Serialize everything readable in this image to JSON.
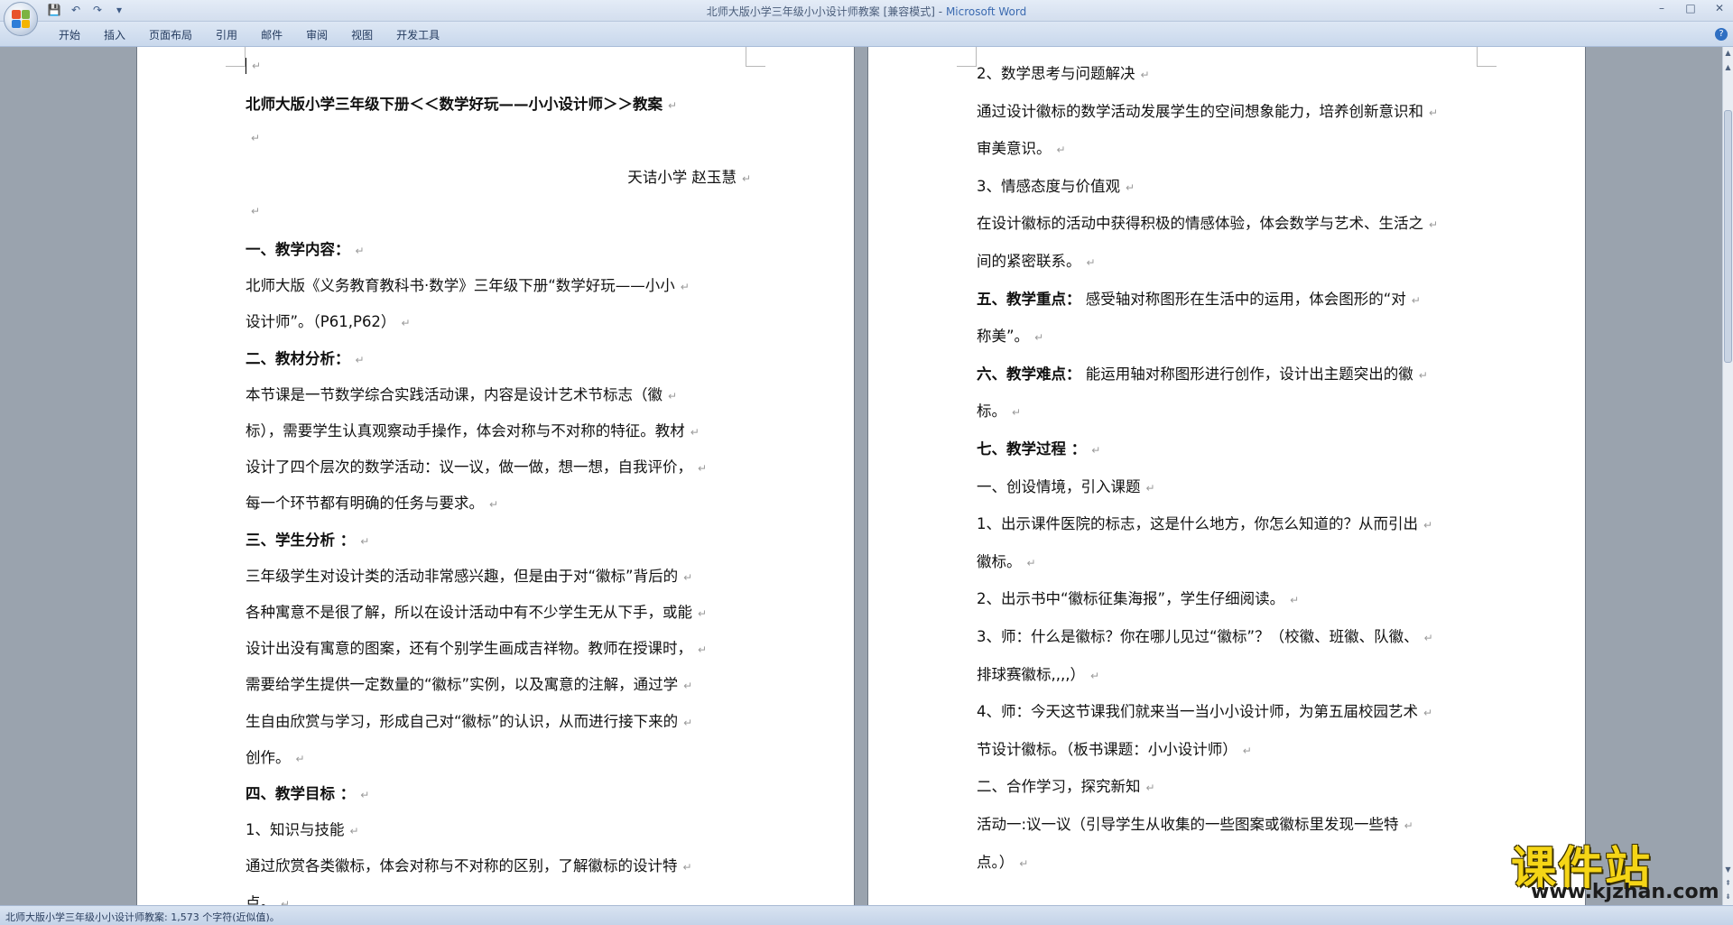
{
  "window": {
    "title_doc": "北师大版小学三年级小小设计师教案 [兼容模式]",
    "title_sep": " - ",
    "title_app": "Microsoft Word",
    "minimize": "–",
    "maximize": "□",
    "close": "✕"
  },
  "qat": {
    "save": "💾",
    "undo": "↶",
    "redo": "↷",
    "more": "▾"
  },
  "ribbon": {
    "tabs": [
      "开始",
      "插入",
      "页面布局",
      "引用",
      "邮件",
      "审阅",
      "视图",
      "开发工具"
    ],
    "help": "?"
  },
  "page1": {
    "lines": [
      {
        "text": "",
        "bold": false
      },
      {
        "text": "北师大版小学三年级下册＜＜数学好玩——小小设计师＞＞教案",
        "bold": true
      },
      {
        "text": "",
        "bold": false
      },
      {
        "text": "天诘小学    赵玉慧",
        "bold": false,
        "align": "right"
      },
      {
        "text": "",
        "bold": false
      },
      {
        "text": "一、教学内容：",
        "bold": true
      },
      {
        "text": "北师大版《义务教育教科书·数学》三年级下册“数学好玩——小小",
        "bold": false
      },
      {
        "text": "设计师”。（P61,P62）",
        "bold": false
      },
      {
        "text": "二、教材分析：",
        "bold": true
      },
      {
        "text": "  本节课是一节数学综合实践活动课，内容是设计艺术节标志（徽",
        "bold": false
      },
      {
        "text": "标），需要学生认真观察动手操作，体会对称与不对称的特征。教材",
        "bold": false
      },
      {
        "text": "设计了四个层次的数学活动：议一议，做一做，想一想，自我评价，",
        "bold": false
      },
      {
        "text": "每一个环节都有明确的任务与要求。",
        "bold": false
      },
      {
        "text": "三、学生分析  ：",
        "bold": true
      },
      {
        "text": "三年级学生对设计类的活动非常感兴趣，但是由于对“徽标”背后的",
        "bold": false
      },
      {
        "text": "各种寓意不是很了解，所以在设计活动中有不少学生无从下手，或能",
        "bold": false
      },
      {
        "text": "设计出没有寓意的图案，还有个别学生画成吉祥物。教师在授课时，",
        "bold": false
      },
      {
        "text": "需要给学生提供一定数量的“徽标”实例，以及寓意的注解，通过学",
        "bold": false
      },
      {
        "text": "生自由欣赏与学习，形成自己对“徽标”的认识，从而进行接下来的",
        "bold": false
      },
      {
        "text": "创作。",
        "bold": false
      },
      {
        "text": "四、教学目标  ：",
        "bold": true
      },
      {
        "text": "1、知识与技能",
        "bold": false
      },
      {
        "text": "通过欣赏各类徽标，体会对称与不对称的区别，了解徽标的设计特",
        "bold": false
      },
      {
        "text": "点。",
        "bold": false
      }
    ]
  },
  "page2": {
    "lines": [
      {
        "text": "2、数学思考与问题解决",
        "bold": false
      },
      {
        "text": "通过设计徽标的数学活动发展学生的空间想象能力，培养创新意识和",
        "bold": false
      },
      {
        "text": "审美意识。",
        "bold": false
      },
      {
        "text": "3、情感态度与价值观",
        "bold": false
      },
      {
        "text": "在设计徽标的活动中获得积极的情感体验，体会数学与艺术、生活之",
        "bold": false
      },
      {
        "text": "间的紧密联系。",
        "bold": false
      },
      {
        "text": "五、教学重点：",
        "bold": true,
        "rest": "    感受轴对称图形在生活中的运用，体会图形的“对"
      },
      {
        "text": "称美”。",
        "bold": false
      },
      {
        "text": "六、教学难点：",
        "bold": true,
        "rest": "    能运用轴对称图形进行创作，设计出主题突出的徽"
      },
      {
        "text": "标。",
        "bold": false
      },
      {
        "text": "七、教学过程  ：",
        "bold": true
      },
      {
        "text": "一、创设情境，引入课题",
        "bold": false
      },
      {
        "text": "1、出示课件医院的标志，这是什么地方，你怎么知道的？从而引出",
        "bold": false
      },
      {
        "text": "徽标。",
        "bold": false
      },
      {
        "text": "2、出示书中“徽标征集海报”，学生仔细阅读。",
        "bold": false
      },
      {
        "text": "3、师：什么是徽标？你在哪儿见过“徽标”？（校徽、班徽、队徽、",
        "bold": false
      },
      {
        "text": "排球赛徽标,,,,）",
        "bold": false
      },
      {
        "text": "4、师：今天这节课我们就来当一当小小设计师，为第五届校园艺术",
        "bold": false
      },
      {
        "text": "节设计徽标。（板书课题：小小设计师）",
        "bold": false
      },
      {
        "text": "二、合作学习，探究新知",
        "bold": false
      },
      {
        "text": "活动一:议一议（引导学生从收集的一些图案或徽标里发现一些特",
        "bold": false
      },
      {
        "text": "点。）",
        "bold": false
      }
    ]
  },
  "paragraph_mark": "↵",
  "status": {
    "text": "北师大版小学三年级小小设计师教案: 1,573 个字符(近似值)。"
  },
  "watermark": {
    "cn": "课件站",
    "en": "www.kjzhan.com"
  },
  "colors": {
    "accent": "#3b6ab0",
    "watermark_yellow": "#f5d516"
  }
}
